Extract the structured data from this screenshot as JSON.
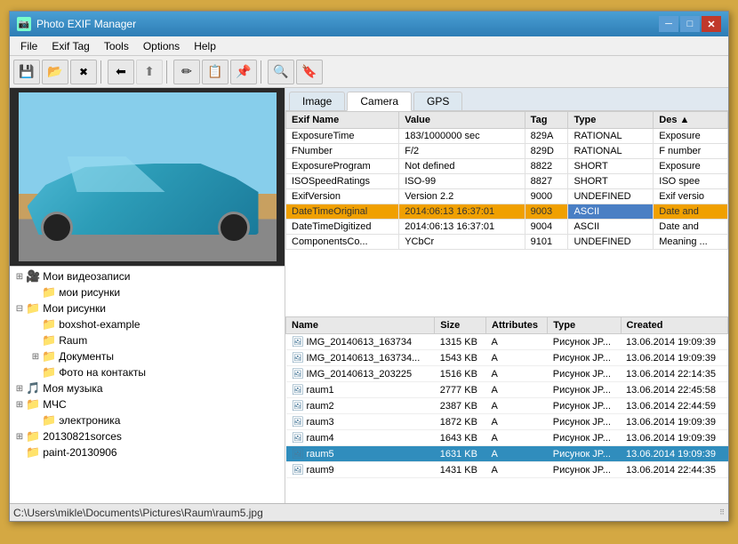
{
  "window": {
    "title": "Photo EXIF Manager",
    "icon": "📷"
  },
  "titlebar": {
    "min_label": "─",
    "max_label": "□",
    "close_label": "✕"
  },
  "menubar": {
    "items": [
      {
        "label": "File",
        "id": "file"
      },
      {
        "label": "Exif Tag",
        "id": "exiftag"
      },
      {
        "label": "Tools",
        "id": "tools"
      },
      {
        "label": "Options",
        "id": "options"
      },
      {
        "label": "Help",
        "id": "help"
      }
    ]
  },
  "toolbar": {
    "buttons": [
      {
        "icon": "💾",
        "name": "save"
      },
      {
        "icon": "📂",
        "name": "open"
      },
      {
        "icon": "❌",
        "name": "delete"
      },
      {
        "icon": "⬅",
        "name": "back"
      },
      {
        "icon": "⬆",
        "name": "up"
      },
      {
        "icon": "✏",
        "name": "edit"
      },
      {
        "icon": "📋",
        "name": "copy"
      },
      {
        "icon": "📌",
        "name": "pin"
      },
      {
        "icon": "🔖",
        "name": "bookmark"
      }
    ]
  },
  "tabs": {
    "items": [
      {
        "label": "Image",
        "id": "image",
        "active": false
      },
      {
        "label": "Camera",
        "id": "camera",
        "active": true
      },
      {
        "label": "GPS",
        "id": "gps",
        "active": false
      }
    ]
  },
  "exif_table": {
    "columns": [
      {
        "label": "Exif Name",
        "id": "name"
      },
      {
        "label": "Value",
        "id": "value"
      },
      {
        "label": "Tag",
        "id": "tag"
      },
      {
        "label": "Type",
        "id": "type"
      },
      {
        "label": "Des",
        "id": "description"
      }
    ],
    "rows": [
      {
        "name": "ExposureTime",
        "value": "183/1000000 sec",
        "tag": "829A",
        "type": "RATIONAL",
        "desc": "Exposure",
        "selected": false
      },
      {
        "name": "FNumber",
        "value": "F/2",
        "tag": "829D",
        "type": "RATIONAL",
        "desc": "F number",
        "selected": false
      },
      {
        "name": "ExposureProgram",
        "value": "Not defined",
        "tag": "8822",
        "type": "SHORT",
        "desc": "Exposure",
        "selected": false
      },
      {
        "name": "ISOSpeedRatings",
        "value": "ISO-99",
        "tag": "8827",
        "type": "SHORT",
        "desc": "ISO spee",
        "selected": false
      },
      {
        "name": "ExifVersion",
        "value": "Version 2.2",
        "tag": "9000",
        "type": "UNDEFINED",
        "desc": "Exif versio",
        "selected": false
      },
      {
        "name": "DateTimeOriginal",
        "value": "2014:06:13 16:37:01",
        "tag": "9003",
        "type": "ASCII",
        "desc": "Date and",
        "selected": true
      },
      {
        "name": "DateTimeDigitized",
        "value": "2014:06:13 16:37:01",
        "tag": "9004",
        "type": "ASCII",
        "desc": "Date and",
        "selected": false
      },
      {
        "name": "ComponentsCo...",
        "value": "YCbCr",
        "tag": "9101",
        "type": "UNDEFINED",
        "desc": "Meaning ...",
        "selected": false
      }
    ]
  },
  "file_tree": {
    "items": [
      {
        "indent": 0,
        "expand": "⊞",
        "icon": "🎥",
        "label": "Мои видеозаписи",
        "selected": false
      },
      {
        "indent": 1,
        "expand": " ",
        "icon": "📁",
        "label": "мои рисунки",
        "selected": false
      },
      {
        "indent": 0,
        "expand": "⊟",
        "icon": "📁",
        "label": "Мои рисунки",
        "selected": false
      },
      {
        "indent": 1,
        "expand": " ",
        "icon": "📁",
        "label": "boxshot-example",
        "selected": false
      },
      {
        "indent": 1,
        "expand": " ",
        "icon": "📁",
        "label": "Raum",
        "selected": false
      },
      {
        "indent": 1,
        "expand": "⊞",
        "icon": "📁",
        "label": "Документы",
        "selected": false
      },
      {
        "indent": 1,
        "expand": " ",
        "icon": "📁",
        "label": "Фото на контакты",
        "selected": false
      },
      {
        "indent": 0,
        "expand": "⊞",
        "icon": "🎵",
        "label": "Моя музыка",
        "selected": false
      },
      {
        "indent": 0,
        "expand": "⊞",
        "icon": "📁",
        "label": "МЧС",
        "selected": false
      },
      {
        "indent": 1,
        "expand": " ",
        "icon": "📁",
        "label": "электроника",
        "selected": false
      },
      {
        "indent": 0,
        "expand": "⊞",
        "icon": "📁",
        "label": "20130821sorces",
        "selected": false
      },
      {
        "indent": 0,
        "expand": " ",
        "icon": "📁",
        "label": "paint-20130906",
        "selected": false
      }
    ]
  },
  "file_list": {
    "columns": [
      {
        "label": "Name",
        "id": "name"
      },
      {
        "label": "Size",
        "id": "size"
      },
      {
        "label": "Attributes",
        "id": "attrs"
      },
      {
        "label": "Type",
        "id": "type"
      },
      {
        "label": "Created",
        "id": "created"
      }
    ],
    "rows": [
      {
        "name": "IMG_20140613_163734",
        "size": "1315 KB",
        "attrs": "A",
        "type": "Рисунок JP...",
        "created": "13.06.2014 19:09:39",
        "selected": false
      },
      {
        "name": "IMG_20140613_163734...",
        "size": "1543 KB",
        "attrs": "A",
        "type": "Рисунок JP...",
        "created": "13.06.2014 19:09:39",
        "selected": false
      },
      {
        "name": "IMG_20140613_203225",
        "size": "1516 KB",
        "attrs": "A",
        "type": "Рисунок JP...",
        "created": "13.06.2014 22:14:35",
        "selected": false
      },
      {
        "name": "raum1",
        "size": "2777 KB",
        "attrs": "A",
        "type": "Рисунок JP...",
        "created": "13.06.2014 22:45:58",
        "selected": false
      },
      {
        "name": "raum2",
        "size": "2387 KB",
        "attrs": "A",
        "type": "Рисунок JP...",
        "created": "13.06.2014 22:44:59",
        "selected": false
      },
      {
        "name": "raum3",
        "size": "1872 KB",
        "attrs": "A",
        "type": "Рисунок JP...",
        "created": "13.06.2014 19:09:39",
        "selected": false
      },
      {
        "name": "raum4",
        "size": "1643 KB",
        "attrs": "A",
        "type": "Рисунок JP...",
        "created": "13.06.2014 19:09:39",
        "selected": false
      },
      {
        "name": "raum5",
        "size": "1631 KB",
        "attrs": "A",
        "type": "Рисунок JP...",
        "created": "13.06.2014 19:09:39",
        "selected": true
      },
      {
        "name": "raum9",
        "size": "1431 KB",
        "attrs": "A",
        "type": "Рисунок JP...",
        "created": "13.06.2014 22:44:35",
        "selected": false
      }
    ]
  },
  "statusbar": {
    "path": "C:\\Users\\mikle\\Documents\\Pictures\\Raum\\raum5.jpg"
  }
}
